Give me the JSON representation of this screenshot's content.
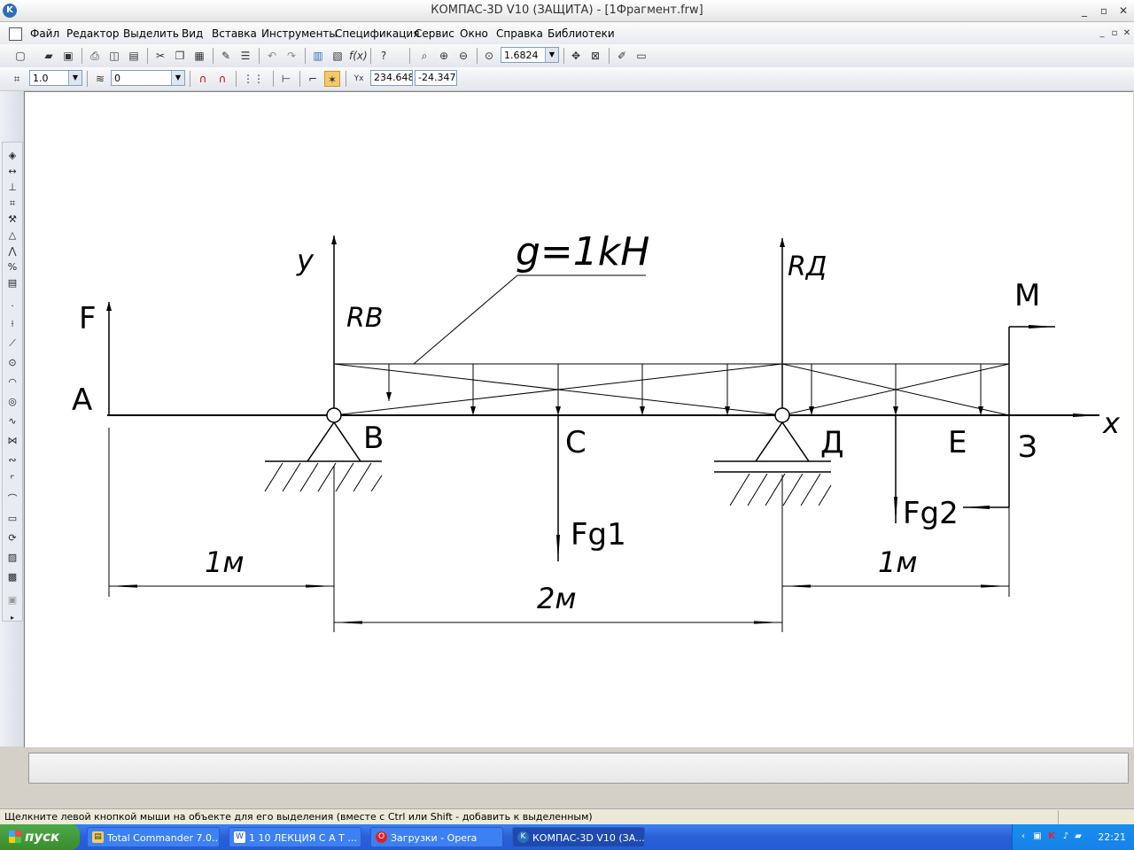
{
  "window": {
    "title": "КОМПАС-3D V10 (ЗАЩИТА) - [1Фрагмент.frw]",
    "minimize": "_",
    "restore": "▫",
    "close": "✕"
  },
  "menu": {
    "items": [
      "Файл",
      "Редактор",
      "Выделить",
      "Вид",
      "Вставка",
      "Инструменты",
      "Спецификация",
      "Сервис",
      "Окно",
      "Справка",
      "Библиотеки"
    ]
  },
  "toolbar_view": {
    "zoom_value": "1.6824"
  },
  "toolbar_current": {
    "step": "1.0",
    "layer": "0",
    "coord_x": "234.648",
    "coord_y": "-24.347"
  },
  "drawing": {
    "load_label": "g=1kH",
    "labels": {
      "A": "A",
      "B": "B",
      "C": "C",
      "D": "Д",
      "E": "E",
      "Z": "З",
      "F": "F",
      "RB": "RB",
      "RD": "RД",
      "M": "M",
      "Fg1": "Fg1",
      "Fg2": "Fg2",
      "axis_x": "x",
      "axis_y": "y"
    },
    "dims": {
      "d1": "1м",
      "d2": "2м",
      "d3": "1м"
    }
  },
  "status": {
    "hint": "Щелкните левой кнопкой мыши на объекте для его выделения (вместе с Ctrl или Shift - добавить к выделенным)"
  },
  "taskbar": {
    "start_label": "пуск",
    "tasks": [
      {
        "label": "Total Commander 7.0..."
      },
      {
        "label": "1 10 ЛЕКЦИЯ С А Т ..."
      },
      {
        "label": "Загрузки - Opera"
      },
      {
        "label": "КОМПАС-3D V10 (ЗА..."
      }
    ],
    "clock": "22:21"
  },
  "colors": {
    "accent": "#2d6fb8",
    "taskbar": "#245bd8",
    "start": "#3b8c2b"
  }
}
